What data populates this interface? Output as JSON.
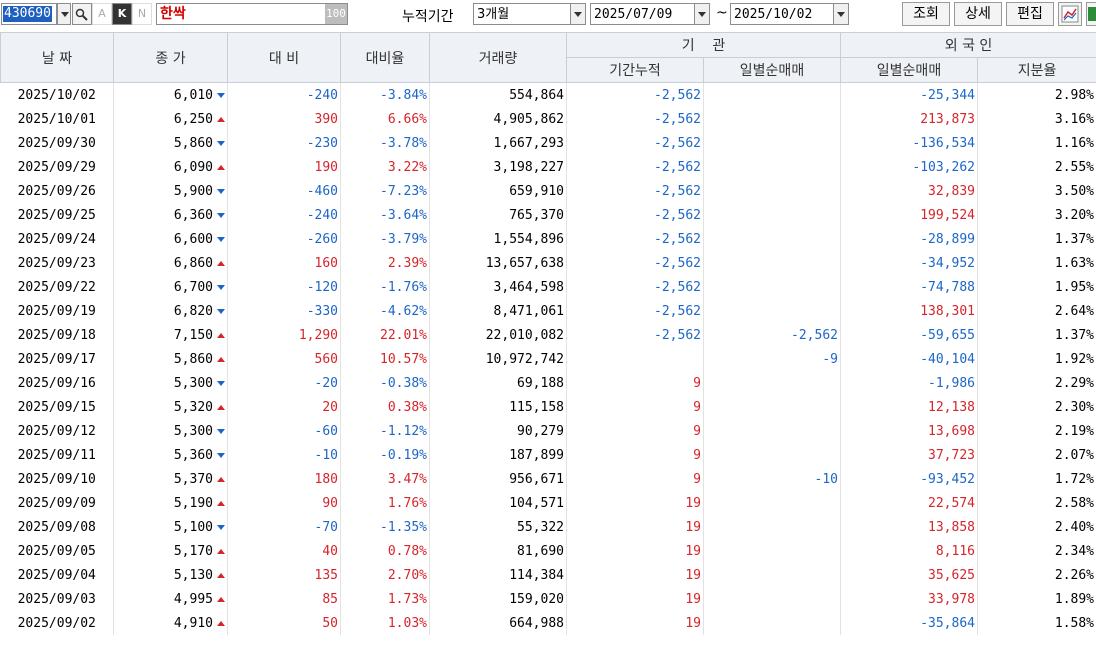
{
  "toolbar": {
    "code": "430690",
    "btn_a": "A",
    "btn_k": "K",
    "btn_n": "N",
    "stock_name": "한싹",
    "name_badge": "100",
    "period_label": "누적기간",
    "period_value": "3개월",
    "start_date": "2025/07/09",
    "tilde": "~",
    "end_date": "2025/10/02",
    "query_label": "조회",
    "detail_label": "상세",
    "edit_label": "편집"
  },
  "headers": {
    "date": "날 짜",
    "close": "종 가",
    "change": "대 비",
    "rate": "대비율",
    "volume": "거래량",
    "inst_group": "기    관",
    "inst_cum": "기간누적",
    "inst_daily": "일별순매매",
    "foreign_group": "외 국 인",
    "foreign_daily": "일별순매매",
    "foreign_ratio": "지분율"
  },
  "colors": {
    "up": "#d6242a",
    "down": "#1c66c8"
  },
  "rows": [
    {
      "date": "2025/10/02",
      "close": "6,010",
      "dir": "down",
      "change": "-240",
      "rate": "-3.84%",
      "volume": "554,864",
      "inst_cum": "-2,562",
      "inst_daily": "",
      "foreign_daily": "-25,344",
      "foreign_ratio": "2.98%"
    },
    {
      "date": "2025/10/01",
      "close": "6,250",
      "dir": "up",
      "change": "390",
      "rate": "6.66%",
      "volume": "4,905,862",
      "inst_cum": "-2,562",
      "inst_daily": "",
      "foreign_daily": "213,873",
      "foreign_ratio": "3.16%"
    },
    {
      "date": "2025/09/30",
      "close": "5,860",
      "dir": "down",
      "change": "-230",
      "rate": "-3.78%",
      "volume": "1,667,293",
      "inst_cum": "-2,562",
      "inst_daily": "",
      "foreign_daily": "-136,534",
      "foreign_ratio": "1.16%"
    },
    {
      "date": "2025/09/29",
      "close": "6,090",
      "dir": "up",
      "change": "190",
      "rate": "3.22%",
      "volume": "3,198,227",
      "inst_cum": "-2,562",
      "inst_daily": "",
      "foreign_daily": "-103,262",
      "foreign_ratio": "2.55%"
    },
    {
      "date": "2025/09/26",
      "close": "5,900",
      "dir": "down",
      "change": "-460",
      "rate": "-7.23%",
      "volume": "659,910",
      "inst_cum": "-2,562",
      "inst_daily": "",
      "foreign_daily": "32,839",
      "foreign_ratio": "3.50%"
    },
    {
      "date": "2025/09/25",
      "close": "6,360",
      "dir": "down",
      "change": "-240",
      "rate": "-3.64%",
      "volume": "765,370",
      "inst_cum": "-2,562",
      "inst_daily": "",
      "foreign_daily": "199,524",
      "foreign_ratio": "3.20%"
    },
    {
      "date": "2025/09/24",
      "close": "6,600",
      "dir": "down",
      "change": "-260",
      "rate": "-3.79%",
      "volume": "1,554,896",
      "inst_cum": "-2,562",
      "inst_daily": "",
      "foreign_daily": "-28,899",
      "foreign_ratio": "1.37%"
    },
    {
      "date": "2025/09/23",
      "close": "6,860",
      "dir": "up",
      "change": "160",
      "rate": "2.39%",
      "volume": "13,657,638",
      "inst_cum": "-2,562",
      "inst_daily": "",
      "foreign_daily": "-34,952",
      "foreign_ratio": "1.63%"
    },
    {
      "date": "2025/09/22",
      "close": "6,700",
      "dir": "down",
      "change": "-120",
      "rate": "-1.76%",
      "volume": "3,464,598",
      "inst_cum": "-2,562",
      "inst_daily": "",
      "foreign_daily": "-74,788",
      "foreign_ratio": "1.95%"
    },
    {
      "date": "2025/09/19",
      "close": "6,820",
      "dir": "down",
      "change": "-330",
      "rate": "-4.62%",
      "volume": "8,471,061",
      "inst_cum": "-2,562",
      "inst_daily": "",
      "foreign_daily": "138,301",
      "foreign_ratio": "2.64%"
    },
    {
      "date": "2025/09/18",
      "close": "7,150",
      "dir": "up",
      "change": "1,290",
      "rate": "22.01%",
      "volume": "22,010,082",
      "inst_cum": "-2,562",
      "inst_daily": "-2,562",
      "foreign_daily": "-59,655",
      "foreign_ratio": "1.37%"
    },
    {
      "date": "2025/09/17",
      "close": "5,860",
      "dir": "up",
      "change": "560",
      "rate": "10.57%",
      "volume": "10,972,742",
      "inst_cum": "",
      "inst_daily": "-9",
      "foreign_daily": "-40,104",
      "foreign_ratio": "1.92%"
    },
    {
      "date": "2025/09/16",
      "close": "5,300",
      "dir": "down",
      "change": "-20",
      "rate": "-0.38%",
      "volume": "69,188",
      "inst_cum": "9",
      "inst_daily": "",
      "foreign_daily": "-1,986",
      "foreign_ratio": "2.29%"
    },
    {
      "date": "2025/09/15",
      "close": "5,320",
      "dir": "up",
      "change": "20",
      "rate": "0.38%",
      "volume": "115,158",
      "inst_cum": "9",
      "inst_daily": "",
      "foreign_daily": "12,138",
      "foreign_ratio": "2.30%"
    },
    {
      "date": "2025/09/12",
      "close": "5,300",
      "dir": "down",
      "change": "-60",
      "rate": "-1.12%",
      "volume": "90,279",
      "inst_cum": "9",
      "inst_daily": "",
      "foreign_daily": "13,698",
      "foreign_ratio": "2.19%"
    },
    {
      "date": "2025/09/11",
      "close": "5,360",
      "dir": "down",
      "change": "-10",
      "rate": "-0.19%",
      "volume": "187,899",
      "inst_cum": "9",
      "inst_daily": "",
      "foreign_daily": "37,723",
      "foreign_ratio": "2.07%"
    },
    {
      "date": "2025/09/10",
      "close": "5,370",
      "dir": "up",
      "change": "180",
      "rate": "3.47%",
      "volume": "956,671",
      "inst_cum": "9",
      "inst_daily": "-10",
      "foreign_daily": "-93,452",
      "foreign_ratio": "1.72%"
    },
    {
      "date": "2025/09/09",
      "close": "5,190",
      "dir": "up",
      "change": "90",
      "rate": "1.76%",
      "volume": "104,571",
      "inst_cum": "19",
      "inst_daily": "",
      "foreign_daily": "22,574",
      "foreign_ratio": "2.58%"
    },
    {
      "date": "2025/09/08",
      "close": "5,100",
      "dir": "down",
      "change": "-70",
      "rate": "-1.35%",
      "volume": "55,322",
      "inst_cum": "19",
      "inst_daily": "",
      "foreign_daily": "13,858",
      "foreign_ratio": "2.40%"
    },
    {
      "date": "2025/09/05",
      "close": "5,170",
      "dir": "up",
      "change": "40",
      "rate": "0.78%",
      "volume": "81,690",
      "inst_cum": "19",
      "inst_daily": "",
      "foreign_daily": "8,116",
      "foreign_ratio": "2.34%"
    },
    {
      "date": "2025/09/04",
      "close": "5,130",
      "dir": "up",
      "change": "135",
      "rate": "2.70%",
      "volume": "114,384",
      "inst_cum": "19",
      "inst_daily": "",
      "foreign_daily": "35,625",
      "foreign_ratio": "2.26%"
    },
    {
      "date": "2025/09/03",
      "close": "4,995",
      "dir": "up",
      "change": "85",
      "rate": "1.73%",
      "volume": "159,020",
      "inst_cum": "19",
      "inst_daily": "",
      "foreign_daily": "33,978",
      "foreign_ratio": "1.89%"
    },
    {
      "date": "2025/09/02",
      "close": "4,910",
      "dir": "up",
      "change": "50",
      "rate": "1.03%",
      "volume": "664,988",
      "inst_cum": "19",
      "inst_daily": "",
      "foreign_daily": "-35,864",
      "foreign_ratio": "1.58%"
    }
  ]
}
